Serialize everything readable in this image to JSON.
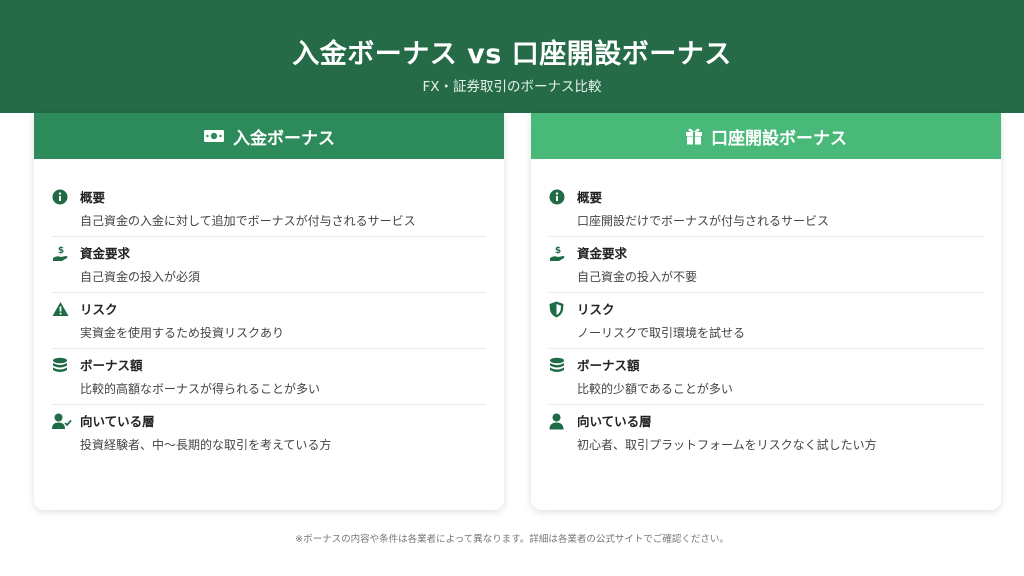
{
  "header": {
    "title": "入金ボーナス vs 口座開設ボーナス",
    "subtitle": "FX・証券取引のボーナス比較"
  },
  "colors": {
    "header_bg": "#256b48",
    "left_accent": "#2d8a5a",
    "right_accent": "#48b978",
    "icon": "#1f6b45"
  },
  "left_card": {
    "title": "入金ボーナス",
    "icon": "money-bill-icon",
    "items": [
      {
        "icon": "info-icon",
        "title": "概要",
        "desc": "自己資金の入金に対して追加でボーナスが付与されるサービス"
      },
      {
        "icon": "hand-dollar-icon",
        "title": "資金要求",
        "desc": "自己資金の投入が必須"
      },
      {
        "icon": "warning-icon",
        "title": "リスク",
        "desc": "実資金を使用するため投資リスクあり"
      },
      {
        "icon": "coins-icon",
        "title": "ボーナス額",
        "desc": "比較的高額なボーナスが得られることが多い"
      },
      {
        "icon": "user-check-icon",
        "title": "向いている層",
        "desc": "投資経験者、中〜長期的な取引を考えている方"
      }
    ]
  },
  "right_card": {
    "title": "口座開設ボーナス",
    "icon": "gift-icon",
    "items": [
      {
        "icon": "info-icon",
        "title": "概要",
        "desc": "口座開設だけでボーナスが付与されるサービス"
      },
      {
        "icon": "hand-dollar-icon",
        "title": "資金要求",
        "desc": "自己資金の投入が不要"
      },
      {
        "icon": "shield-icon",
        "title": "リスク",
        "desc": "ノーリスクで取引環境を試せる"
      },
      {
        "icon": "coins-icon",
        "title": "ボーナス額",
        "desc": "比較的少額であることが多い"
      },
      {
        "icon": "user-icon",
        "title": "向いている層",
        "desc": "初心者、取引プラットフォームをリスクなく試したい方"
      }
    ]
  },
  "footer": {
    "note": "※ボーナスの内容や条件は各業者によって異なります。詳細は各業者の公式サイトでご確認ください。"
  }
}
